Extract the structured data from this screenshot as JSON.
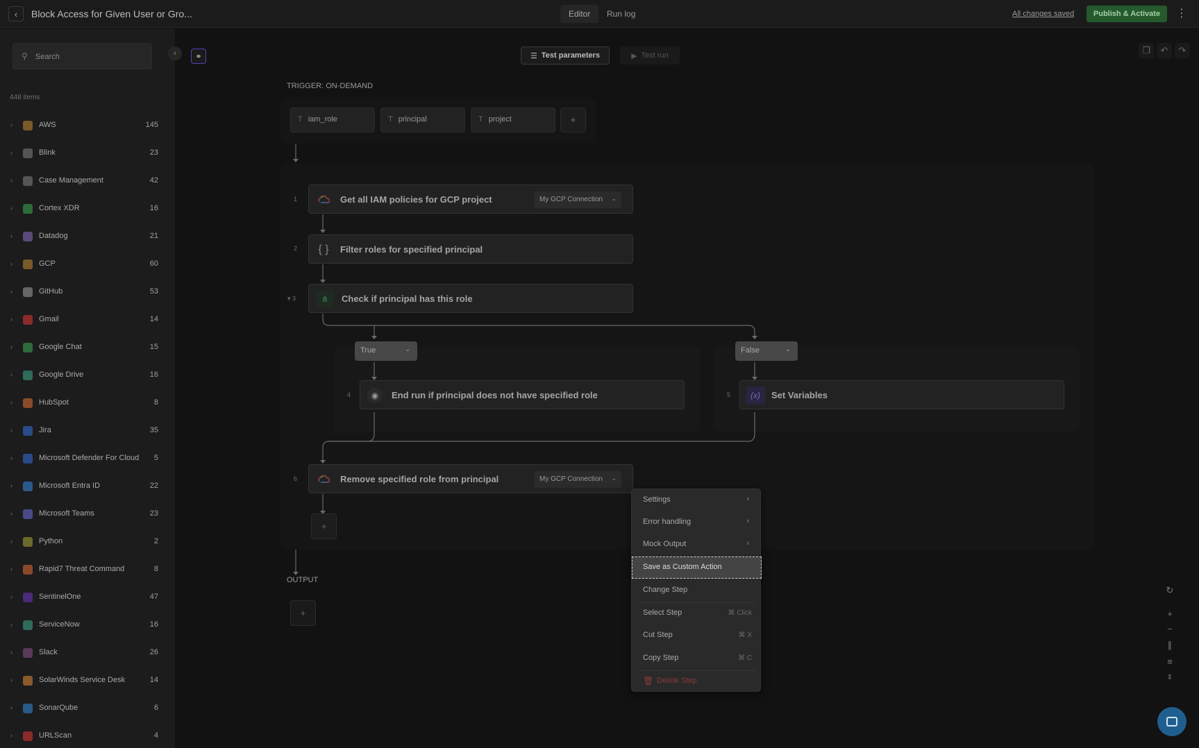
{
  "header": {
    "title": "Block Access for Given User or Gro...",
    "tabs": [
      {
        "label": "Editor"
      },
      {
        "label": "Run log"
      }
    ],
    "saved_status": "All changes saved",
    "publish_label": "Publish & Activate"
  },
  "sidebar": {
    "search_placeholder": "Search",
    "total": "448 items",
    "items": [
      {
        "name": "AWS",
        "count": "145",
        "color": "#7a5a2a"
      },
      {
        "name": "Blink",
        "count": "23",
        "color": "#555555"
      },
      {
        "name": "Case Management",
        "count": "42",
        "color": "#555555"
      },
      {
        "name": "Cortex XDR",
        "count": "16",
        "color": "#2e6b3a"
      },
      {
        "name": "Datadog",
        "count": "21",
        "color": "#5a4a7a"
      },
      {
        "name": "GCP",
        "count": "60",
        "color": "#7a5a2a"
      },
      {
        "name": "GitHub",
        "count": "53",
        "color": "#666666"
      },
      {
        "name": "Gmail",
        "count": "14",
        "color": "#8a2a2a"
      },
      {
        "name": "Google Chat",
        "count": "15",
        "color": "#2e6b3a"
      },
      {
        "name": "Google Drive",
        "count": "16",
        "color": "#2e6b5a"
      },
      {
        "name": "HubSpot",
        "count": "8",
        "color": "#8a4a2a"
      },
      {
        "name": "Jira",
        "count": "35",
        "color": "#2a4a8a"
      },
      {
        "name": "Microsoft Defender For Cloud",
        "count": "5",
        "color": "#2a4a8a"
      },
      {
        "name": "Microsoft Entra ID",
        "count": "22",
        "color": "#2a5a8a"
      },
      {
        "name": "Microsoft Teams",
        "count": "23",
        "color": "#4a4a8a"
      },
      {
        "name": "Python",
        "count": "2",
        "color": "#6a6a2a"
      },
      {
        "name": "Rapid7 Threat Command",
        "count": "8",
        "color": "#8a4a2a"
      },
      {
        "name": "SentinelOne",
        "count": "47",
        "color": "#4a2a7a"
      },
      {
        "name": "ServiceNow",
        "count": "16",
        "color": "#2e6b5a"
      },
      {
        "name": "Slack",
        "count": "26",
        "color": "#5a3a5a"
      },
      {
        "name": "SolarWinds Service Desk",
        "count": "14",
        "color": "#8a5a2a"
      },
      {
        "name": "SonarQube",
        "count": "6",
        "color": "#2a5a8a"
      },
      {
        "name": "URLScan",
        "count": "4",
        "color": "#8a2a2a"
      }
    ]
  },
  "toolbar": {
    "test_params": "Test parameters",
    "test_run": "Test run"
  },
  "workflow": {
    "trigger_label": "TRIGGER: ON-DEMAND",
    "params": [
      "iam_role",
      "principal",
      "project"
    ],
    "output_label": "OUTPUT",
    "steps": {
      "s1": {
        "num": "1",
        "text": "Get all IAM policies for GCP project",
        "connection": "My GCP Connection"
      },
      "s2": {
        "num": "2",
        "text": "Filter roles for specified principal"
      },
      "s3": {
        "num": "▾ 3",
        "text": "Check if principal has this role"
      },
      "s4": {
        "num": "4",
        "text": "End run if principal does not have specified role"
      },
      "s5": {
        "num": "5",
        "text": "Set Variables"
      },
      "s6": {
        "num": "6",
        "text": "Remove specified role from principal",
        "connection": "My GCP Connection"
      }
    },
    "branch_true": "True",
    "branch_false": "False"
  },
  "context_menu": {
    "settings": "Settings",
    "error_handling": "Error handling",
    "mock_output": "Mock Output",
    "save_custom": "Save as Custom Action",
    "change_step": "Change Step",
    "select_step": "Select Step",
    "select_shortcut": "⌘ Click",
    "cut_step": "Cut Step",
    "cut_shortcut": "⌘ X",
    "copy_step": "Copy Step",
    "copy_shortcut": "⌘ C",
    "delete_step": "Delete Step"
  }
}
